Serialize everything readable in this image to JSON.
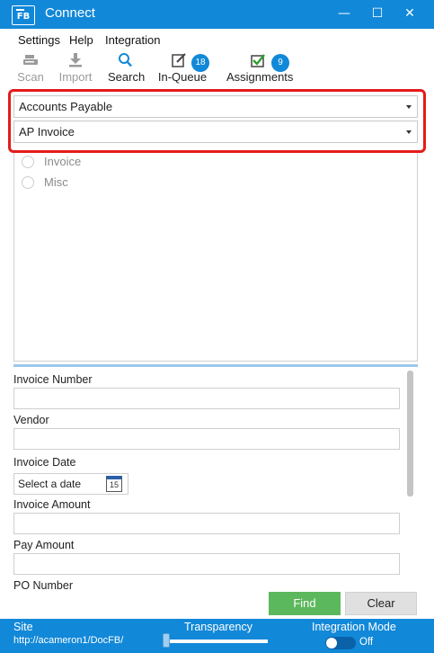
{
  "window": {
    "logo_text": "FB",
    "title": "Connect",
    "minimize_glyph": "—",
    "maximize_glyph": "☐",
    "close_glyph": "✕"
  },
  "menu": {
    "items": [
      {
        "label": "Settings"
      },
      {
        "label": "Help"
      },
      {
        "label": "Integration"
      }
    ]
  },
  "toolbar": {
    "scan": {
      "label": "Scan",
      "icon": "scanner-icon",
      "enabled": false
    },
    "import": {
      "label": "Import",
      "icon": "import-icon",
      "enabled": false
    },
    "search": {
      "label": "Search",
      "icon": "search-icon",
      "enabled": true
    },
    "in_queue": {
      "label": "In-Queue",
      "icon": "edit-icon",
      "badge": "18",
      "enabled": true
    },
    "assignments": {
      "label": "Assignments",
      "icon": "checkbox-icon",
      "badge": "9",
      "enabled": true
    }
  },
  "selectors": {
    "department": "Accounts Payable",
    "document_type": "AP Invoice"
  },
  "radio_options": [
    {
      "label": "Invoice",
      "selected": false
    },
    {
      "label": "Misc",
      "selected": false
    }
  ],
  "fields": {
    "invoice_number": {
      "label": "Invoice Number",
      "value": ""
    },
    "vendor": {
      "label": "Vendor",
      "value": ""
    },
    "invoice_date": {
      "label": "Invoice Date",
      "placeholder": "Select a date",
      "calendar_day": "15"
    },
    "invoice_amount": {
      "label": "Invoice Amount",
      "value": ""
    },
    "pay_amount": {
      "label": "Pay Amount",
      "value": ""
    },
    "po_number": {
      "label": "PO Number"
    }
  },
  "actions": {
    "find_label": "Find",
    "clear_label": "Clear"
  },
  "status": {
    "site_label": "Site",
    "site_url": "http://acameron1/DocFB/",
    "transparency_label": "Transparency",
    "transparency_value": 0,
    "integration_label": "Integration Mode",
    "integration_state": "Off"
  },
  "colors": {
    "accent": "#1288d8",
    "highlight": "#e41b1b",
    "find_button": "#5cb85c"
  }
}
